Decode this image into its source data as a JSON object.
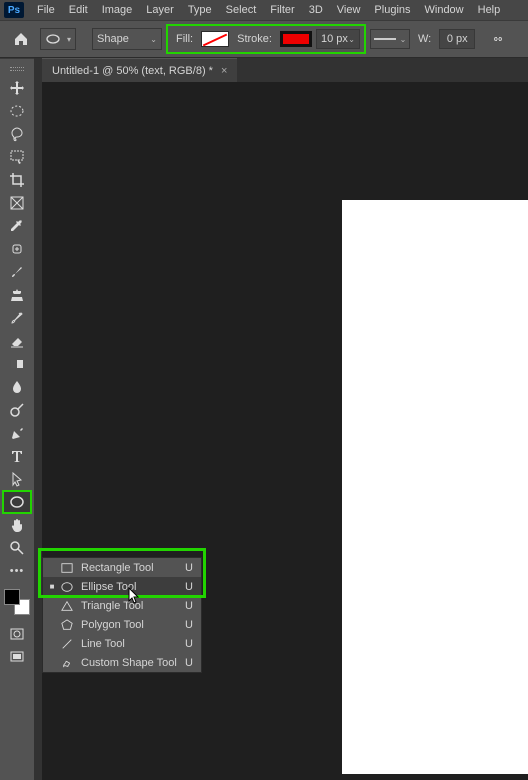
{
  "menubar": {
    "items": [
      "File",
      "Edit",
      "Image",
      "Layer",
      "Type",
      "Select",
      "Filter",
      "3D",
      "View",
      "Plugins",
      "Window",
      "Help"
    ]
  },
  "optionbar": {
    "shape_mode": "Shape",
    "fill_label": "Fill:",
    "stroke_label": "Stroke:",
    "stroke_width": "10 px",
    "w_label": "W:",
    "w_value": "0 px"
  },
  "tab": {
    "title": "Untitled-1 @ 50% (text, RGB/8) *"
  },
  "flyout": {
    "items": [
      {
        "label": "Rectangle Tool",
        "shortcut": "U",
        "selected": false
      },
      {
        "label": "Ellipse Tool",
        "shortcut": "U",
        "selected": true
      },
      {
        "label": "Triangle Tool",
        "shortcut": "U",
        "selected": false
      },
      {
        "label": "Polygon Tool",
        "shortcut": "U",
        "selected": false
      },
      {
        "label": "Line Tool",
        "shortcut": "U",
        "selected": false
      },
      {
        "label": "Custom Shape Tool",
        "shortcut": "U",
        "selected": false
      }
    ]
  },
  "colors": {
    "fg": "#000000",
    "bg": "#ffffff"
  }
}
